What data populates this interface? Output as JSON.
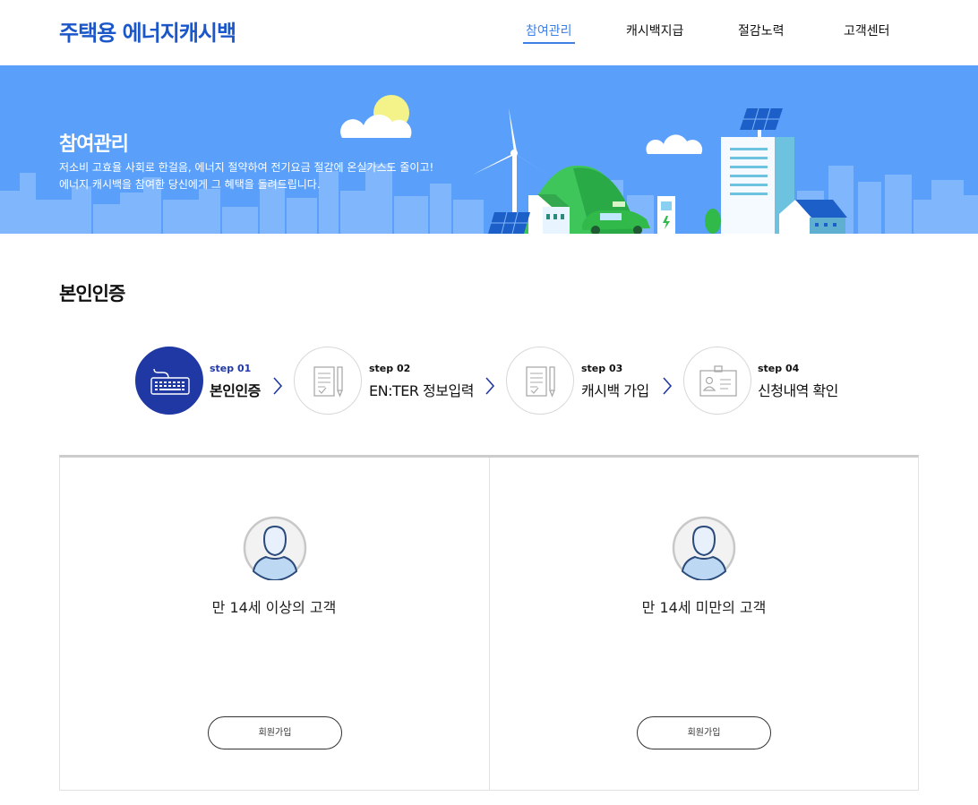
{
  "header": {
    "logo": "주택용 에너지캐시백",
    "nav": [
      {
        "label": "참여관리",
        "active": true
      },
      {
        "label": "캐시백지급",
        "active": false
      },
      {
        "label": "절감노력",
        "active": false
      },
      {
        "label": "고객센터",
        "active": false
      }
    ]
  },
  "banner": {
    "title": "참여관리",
    "desc_line1": "저소비 고효율 사회로 한걸음, 에너지 절약하여 전기요금 절감에 온실가스도 줄이고!",
    "desc_line2": "에너지 캐시백을 참여한 당신에게 그 혜택을 돌려드립니다."
  },
  "section": {
    "title": "본인인증"
  },
  "steps": [
    {
      "num": "step 01",
      "label": "본인인증",
      "icon": "keyboard-icon",
      "active": true
    },
    {
      "num": "step 02",
      "label": "EN:TER 정보입력",
      "icon": "document-pencil-icon",
      "active": false
    },
    {
      "num": "step 03",
      "label": "캐시백 가입",
      "icon": "document-pencil-icon",
      "active": false
    },
    {
      "num": "step 04",
      "label": "신청내역 확인",
      "icon": "id-card-icon",
      "active": false
    }
  ],
  "panels": [
    {
      "label": "만 14세 이상의 고객",
      "button": "회원가입",
      "icon": "user-avatar-icon"
    },
    {
      "label": "만 14세 미만의 고객",
      "button": "회원가입",
      "icon": "user-avatar-icon"
    }
  ],
  "colors": {
    "brand": "#1c57c9",
    "nav_active": "#3f7fe8",
    "banner_bg": "#5aa0fb",
    "step_active": "#2038a4"
  }
}
